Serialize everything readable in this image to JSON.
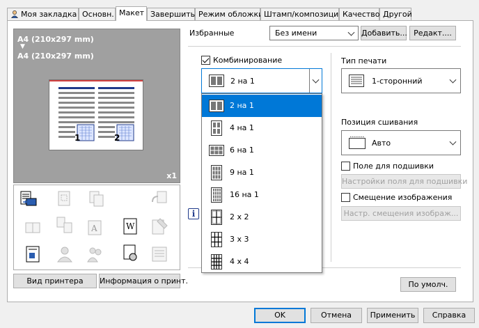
{
  "tabs": [
    {
      "label": "Моя закладка",
      "active": false
    },
    {
      "label": "Основн.",
      "active": false
    },
    {
      "label": "Макет",
      "active": true
    },
    {
      "label": "Завершить",
      "active": false
    },
    {
      "label": "Режим обложки",
      "active": false
    },
    {
      "label": "Штамп/композиция",
      "active": false
    },
    {
      "label": "Качество",
      "active": false
    },
    {
      "label": "Другой",
      "active": false
    }
  ],
  "preview": {
    "original_size": "A4 (210x297 mm)",
    "arrow": "▼",
    "output_size": "A4 (210x297 mm)",
    "copies": "x1",
    "page1": "1",
    "page2": "2"
  },
  "left_buttons": {
    "printer_view": "Вид принтера",
    "printer_info": "Информация о принт."
  },
  "favorites": {
    "label": "Избранные",
    "value": "Без имени",
    "add": "Добавить...",
    "edit": "Редакт...."
  },
  "combine": {
    "checkbox_label": "Комбинирование",
    "checked": true,
    "selected": "2 на 1",
    "options": [
      "2 на 1",
      "4 на 1",
      "6 на 1",
      "9 на 1",
      "16 на 1",
      "2 x 2",
      "3 x 3",
      "4 x 4"
    ]
  },
  "print_type": {
    "label": "Тип печати",
    "value": "1-сторонний"
  },
  "binding": {
    "label": "Позиция сшивания",
    "value": "Авто"
  },
  "binding_margin": {
    "label": "Поле для подшивки",
    "checked": false,
    "settings": "Настройки поля для подшивки"
  },
  "image_shift": {
    "label": "Смещение изображения",
    "checked": false,
    "settings": "Настр. смещения изображ..."
  },
  "info_icon": "i",
  "defaults_button": "По умолч.",
  "footer": {
    "ok": "OK",
    "cancel": "Отмена",
    "apply": "Применить",
    "help": "Справка"
  },
  "colors": {
    "accent": "#0078d7",
    "preview_bg": "#a0a0a0",
    "page_line": "#1f3a8a"
  }
}
